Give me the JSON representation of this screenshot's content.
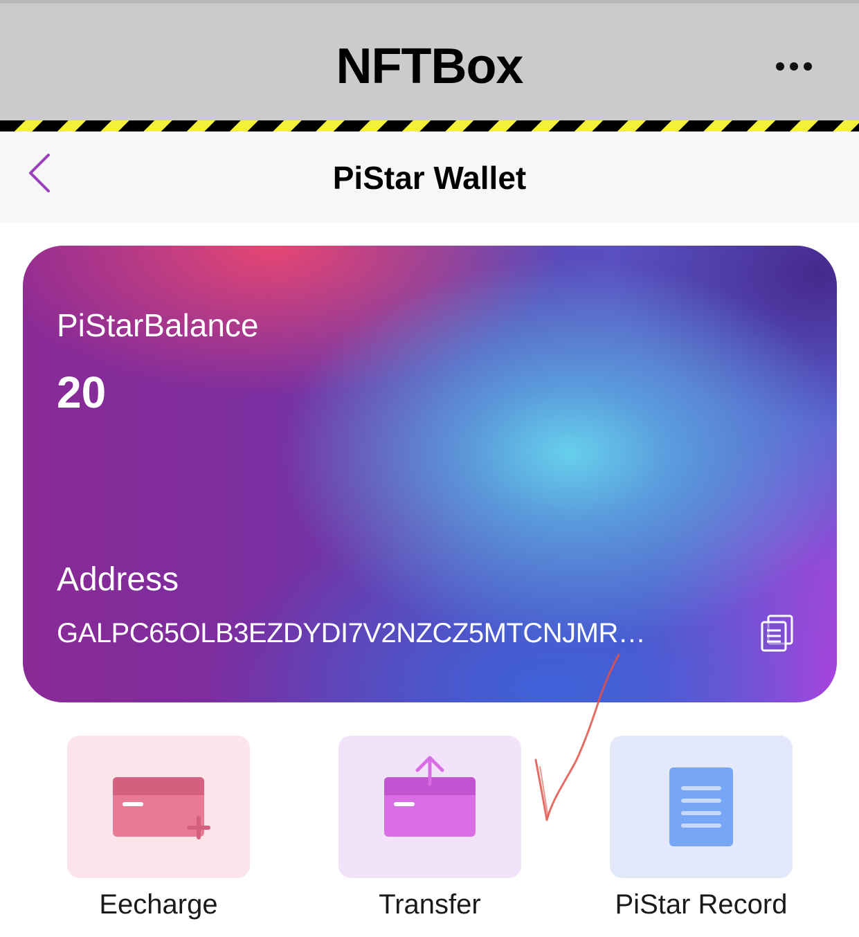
{
  "app_bar": {
    "title": "NFTBox",
    "more_icon": "ellipsis-icon"
  },
  "nav_bar": {
    "back_icon": "chevron-left-icon",
    "title": "PiStar Wallet"
  },
  "wallet_card": {
    "balance_label": "PiStarBalance",
    "balance_value": "20",
    "address_label": "Address",
    "address_value": "GALPC65OLB3EZDYDI7V2NZCZ5MTCNJMR…",
    "copy_icon": "copy-icon"
  },
  "actions": [
    {
      "label": "Eecharge",
      "icon": "card-plus-icon",
      "color": "#e97a96"
    },
    {
      "label": "Transfer",
      "icon": "card-upload-icon",
      "color": "#d96ee4"
    },
    {
      "label": "PiStar Record",
      "icon": "document-icon",
      "color": "#78a6f6"
    }
  ],
  "colors": {
    "app_bar_bg": "#cbcbcb",
    "accent_purple": "#9b3fbf",
    "annotation_red": "#e0524a"
  }
}
